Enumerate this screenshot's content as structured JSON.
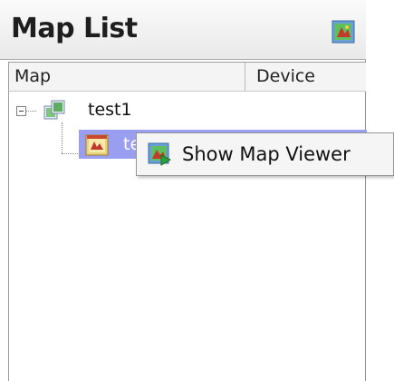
{
  "panel": {
    "title": "Map List",
    "header_button_icon": "map-viewer-icon"
  },
  "columns": {
    "map": "Map",
    "device": "Device"
  },
  "tree": {
    "groups": [
      {
        "label": "test1",
        "icon": "map-group-icon",
        "expanded": true,
        "children": [
          {
            "label": "te",
            "icon": "map-icon",
            "selected": true
          }
        ]
      }
    ]
  },
  "context_menu": {
    "items": [
      {
        "label": "Show Map Viewer",
        "icon": "map-viewer-icon"
      }
    ]
  },
  "colors": {
    "selection": "#9a9ef0",
    "header_bg": "#efefef",
    "menu_bg": "#f5f5f5"
  }
}
